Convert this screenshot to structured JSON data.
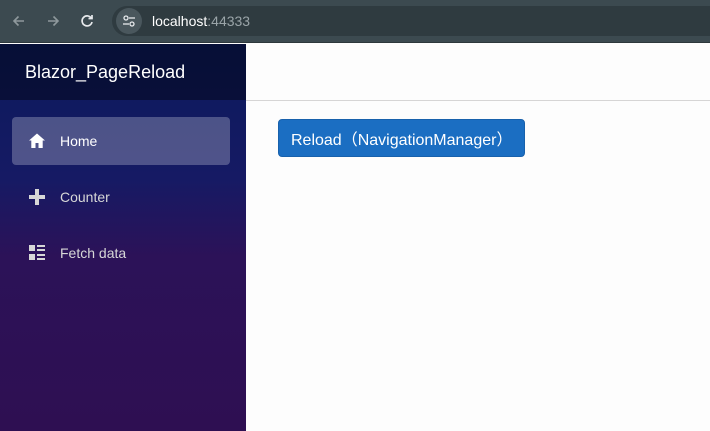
{
  "browser": {
    "back_icon": "arrow-left-icon",
    "forward_icon": "arrow-right-icon",
    "reload_icon": "reload-icon",
    "site_info_icon": "tune-icon",
    "url_host": "localhost",
    "url_port": ":44333"
  },
  "sidebar": {
    "brand": "Blazor_PageReload",
    "items": [
      {
        "label": "Home",
        "icon": "home-icon",
        "active": true
      },
      {
        "label": "Counter",
        "icon": "plus-icon",
        "active": false
      },
      {
        "label": "Fetch data",
        "icon": "list-rich-icon",
        "active": false
      }
    ]
  },
  "main": {
    "reload_button_label": "Reload（NavigationManager）"
  },
  "colors": {
    "primary_button": "#1b6ec2",
    "sidebar_top": "#0b1a5c",
    "sidebar_bottom": "#2e0f52"
  }
}
